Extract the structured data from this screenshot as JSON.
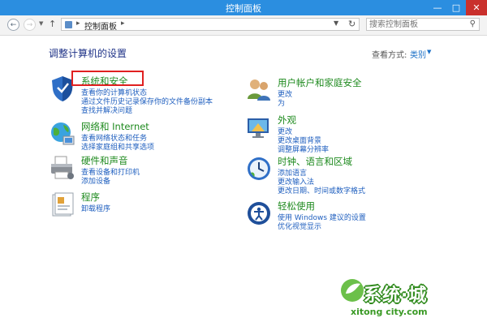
{
  "window": {
    "title": "控制面板"
  },
  "window_buttons": {
    "min": "—",
    "max": "□",
    "close": "✕"
  },
  "address": {
    "crumb": "控制面板",
    "search_placeholder": "搜索控制面板"
  },
  "header": {
    "title": "调整计算机的设置",
    "viewby_label": "查看方式:",
    "viewby_value": "类别"
  },
  "categories_left": [
    {
      "heading": "系统和安全",
      "links": [
        "查看你的计算机状态",
        "通过文件历史记录保存你的文件备份副本",
        "查找并解决问题"
      ]
    },
    {
      "heading": "网络和 Internet",
      "links": [
        "查看网络状态和任务",
        "选择家庭组和共享选项"
      ]
    },
    {
      "heading": "硬件和声音",
      "links": [
        "查看设备和打印机",
        "添加设备"
      ]
    },
    {
      "heading": "程序",
      "links": [
        "卸载程序"
      ]
    }
  ],
  "categories_right": [
    {
      "heading": "用户帐户和家庭安全",
      "links": [
        "更改",
        "为"
      ]
    },
    {
      "heading": "外观",
      "links": [
        "更改",
        "更改桌面背景",
        "调整屏幕分辨率"
      ]
    },
    {
      "heading": "时钟、语言和区域",
      "links": [
        "添加语言",
        "更改输入法",
        "更改日期、时间或数字格式"
      ]
    },
    {
      "heading": "轻松使用",
      "links": [
        "使用 Windows 建议的设置",
        "优化视觉显示"
      ]
    }
  ],
  "logo": {
    "brand": "系统·城",
    "url": "xitong city.com"
  },
  "colors": {
    "titlebar": "#2b8ee0",
    "heading": "#1e8a1e",
    "link": "#1f5fbf",
    "highlight": "#e02020"
  }
}
